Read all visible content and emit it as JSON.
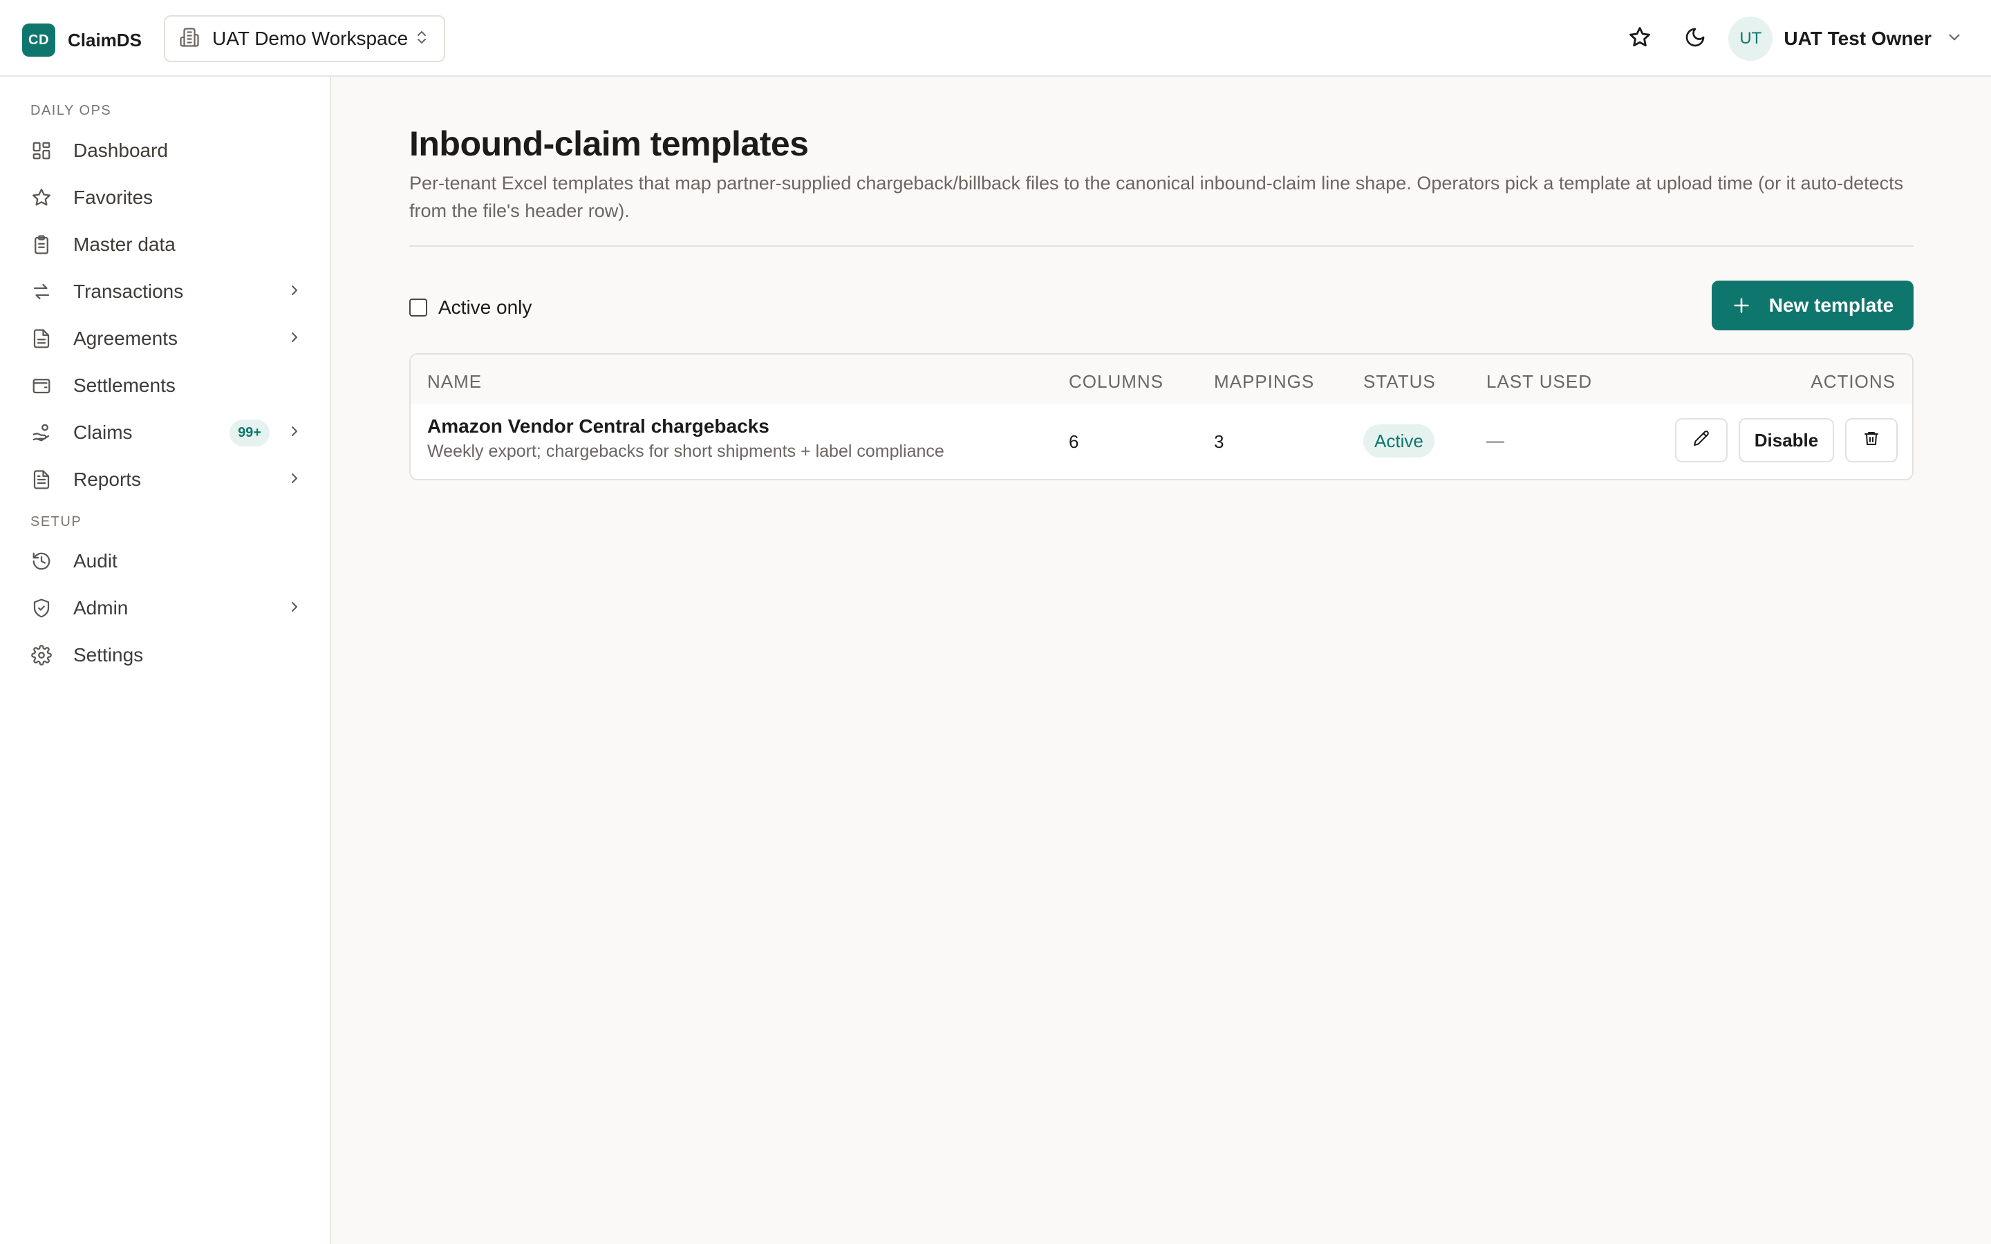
{
  "brand": {
    "logo_text": "CD",
    "name": "ClaimDS"
  },
  "workspace": {
    "name": "UAT Demo Workspace"
  },
  "user": {
    "initials": "UT",
    "name": "UAT Test Owner"
  },
  "sidebar": {
    "sections": [
      {
        "title": "DAILY OPS"
      },
      {
        "title": "SETUP"
      }
    ],
    "items": [
      {
        "label": "Dashboard",
        "icon": "dashboard-icon"
      },
      {
        "label": "Favorites",
        "icon": "star-icon"
      },
      {
        "label": "Master data",
        "icon": "clipboard-icon"
      },
      {
        "label": "Transactions",
        "icon": "arrows-icon"
      },
      {
        "label": "Agreements",
        "icon": "document-icon"
      },
      {
        "label": "Settlements",
        "icon": "wallet-icon"
      },
      {
        "label": "Claims",
        "icon": "hand-coins-icon",
        "badge": "99+"
      },
      {
        "label": "Reports",
        "icon": "report-icon"
      },
      {
        "label": "Audit",
        "icon": "history-icon"
      },
      {
        "label": "Admin",
        "icon": "shield-icon"
      },
      {
        "label": "Settings",
        "icon": "gear-icon"
      }
    ]
  },
  "page": {
    "title": "Inbound-claim templates",
    "description": "Per-tenant Excel templates that map partner-supplied chargeback/billback files to the canonical inbound-claim line shape. Operators pick a template at upload time (or it auto-detects from the file's header row)."
  },
  "filter": {
    "active_only_label": "Active only",
    "active_only_checked": false
  },
  "actions": {
    "new_template_label": "New template"
  },
  "table": {
    "headers": {
      "name": "NAME",
      "columns": "COLUMNS",
      "mappings": "MAPPINGS",
      "status": "STATUS",
      "last_used": "LAST USED",
      "actions": "ACTIONS"
    },
    "rows": [
      {
        "name": "Amazon Vendor Central chargebacks",
        "description": "Weekly export; chargebacks for short shipments + label compliance",
        "columns": "6",
        "mappings": "3",
        "status": "Active",
        "last_used": "—",
        "disable_label": "Disable"
      }
    ]
  },
  "colors": {
    "accent": "#0f766e",
    "accent_soft": "#e6f2f0"
  }
}
